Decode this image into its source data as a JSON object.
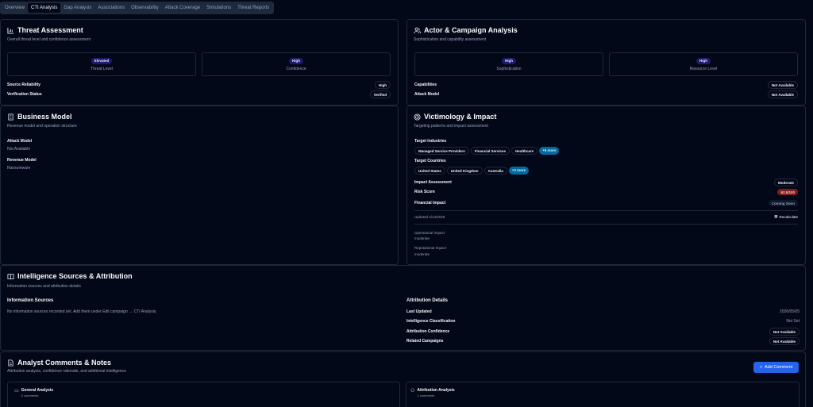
{
  "tabs": [
    "Overview",
    "CTI Analysis",
    "Gap Analysis",
    "Associations",
    "Observability",
    "Attack Coverage",
    "Simulations",
    "Threat Reports"
  ],
  "threat": {
    "title": "Threat Assessment",
    "subtitle": "Overall threat level and confidence assessment",
    "level_badge": "Elevated",
    "level_label": "Threat Level",
    "confidence_badge": "High",
    "confidence_label": "Confidence",
    "reliability_label": "Source Reliability",
    "reliability_value": "High",
    "verification_label": "Verification Status",
    "verification_value": "Verified"
  },
  "actor": {
    "title": "Actor & Campaign Analysis",
    "subtitle": "Sophistication and capability assessment",
    "soph_badge": "High",
    "soph_label": "Sophistication",
    "resource_badge": "High",
    "resource_label": "Resource Level",
    "capabilities_label": "Capabilities",
    "capabilities_value": "Not Available",
    "attack_model_label": "Attack Model",
    "attack_model_value": "Not Available"
  },
  "business": {
    "title": "Business Model",
    "subtitle": "Revenue model and operation structure",
    "attack_model_label": "Attack Model",
    "attack_model_value": "Not Available",
    "revenue_label": "Revenue Model",
    "revenue_value": "Ransomware"
  },
  "victim": {
    "title": "Victimology & Impact",
    "subtitle": "Targeting patterns and impact assessment",
    "industries_label": "Target Industries",
    "industries": [
      "Managed Service Providers",
      "Financial Services",
      "Healthcare"
    ],
    "industries_more": "+5 more",
    "countries_label": "Target Countries",
    "countries": [
      "United States",
      "United Kingdom",
      "Australia"
    ],
    "countries_more": "+3 more",
    "impact_label": "Impact Assessment",
    "impact_value": "Moderate",
    "risk_label": "Risk Score",
    "risk_value": "62.5/100",
    "financial_label": "Financial Impact",
    "financial_value": "Coming Soon",
    "updated": "Updated 1/14/2026",
    "recalc_label": "Recalculate",
    "operational_label": "Operational Impact",
    "operational_value": "moderate",
    "reputational_label": "Reputational Impact",
    "reputational_value": "moderate"
  },
  "sources": {
    "title": "Intelligence Sources & Attribution",
    "subtitle": "Information sources and attribution details",
    "info_label": "Information Sources",
    "info_empty": "No information sources recorded yet. Add them under Edit campaign → CTI Analysis.",
    "attr_label": "Attribution Details",
    "last_updated_label": "Last Updated",
    "last_updated_value": "2026/05/05",
    "classification_label": "Intelligence Classification",
    "classification_value": "Not Set",
    "confidence_label": "Attribution Confidence",
    "confidence_value": "Not Available",
    "related_label": "Related Campaigns",
    "related_value": "Not Available"
  },
  "comments": {
    "title": "Analyst Comments & Notes",
    "subtitle": "Attribution analysis, confidence rationale, and additional intelligence",
    "add_label": "Add Comment",
    "general_title": "General Analysis",
    "general_count": "0 comments",
    "attribution_title": "Attribution Analysis",
    "attribution_count": "1 comments"
  },
  "colors": {
    "accent": "#2563eb",
    "danger": "#7f1d1d",
    "badge_blue": "#1e1b6b",
    "background": "#020817"
  }
}
